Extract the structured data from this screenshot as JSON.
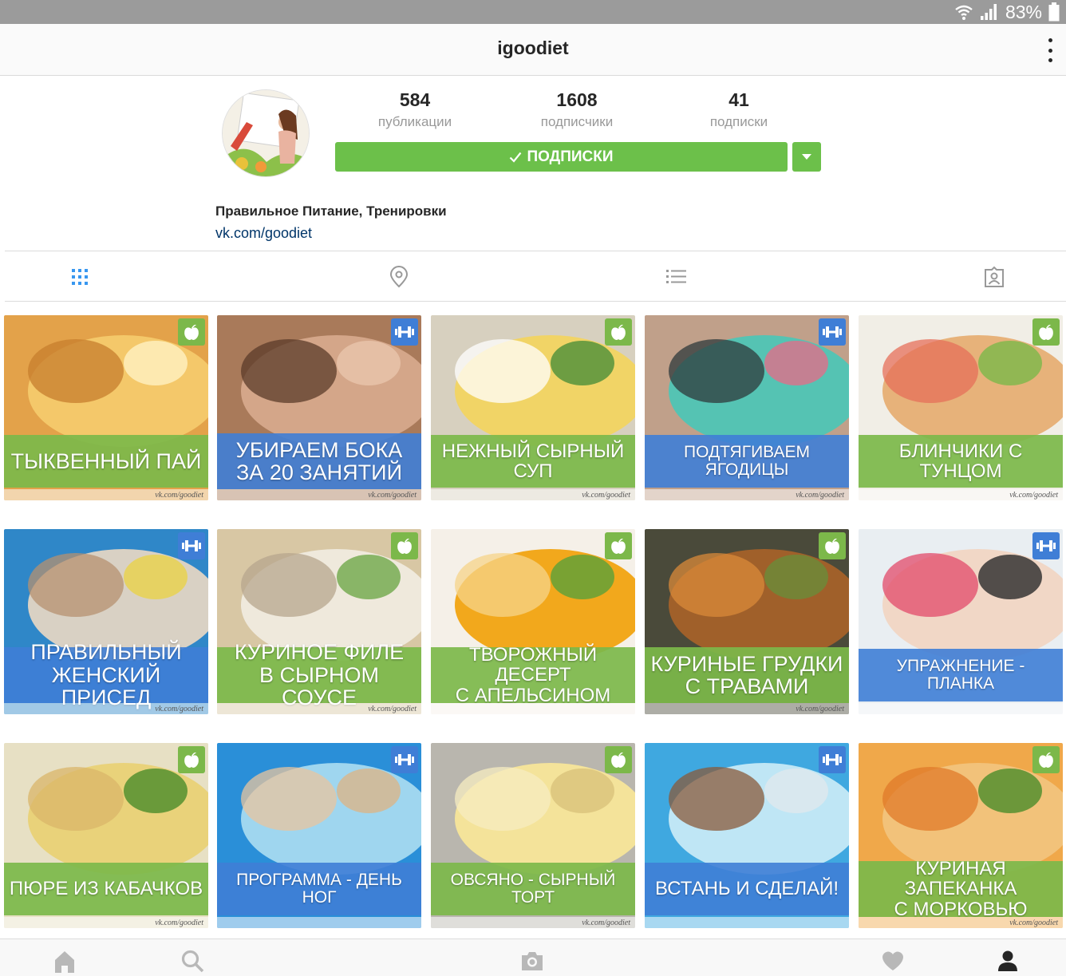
{
  "status_bar": {
    "battery_text": "83%"
  },
  "header": {
    "username": "igoodiet"
  },
  "profile": {
    "stats": [
      {
        "value": "584",
        "label": "публикации"
      },
      {
        "value": "1608",
        "label": "подписчики"
      },
      {
        "value": "41",
        "label": "подписки"
      }
    ],
    "follow_button_label": "ПОДПИСКИ",
    "bio_name": "Правильное Питание, Тренировки",
    "bio_link": "vk.com/goodiet"
  },
  "tabs": [
    "grid-icon",
    "location-pin-icon",
    "list-icon",
    "tagged-person-icon"
  ],
  "colors": {
    "green": "#6cc04a",
    "band_green": "#7cb84a",
    "band_blue": "#3f7ed6",
    "link": "#003569"
  },
  "posts": [
    {
      "line1": "ТЫКВЕННЫЙ ПАЙ",
      "line2": "",
      "badge": "apple-icon",
      "footer": "vk.com/goodiet"
    },
    {
      "line1": "УБИРАЕМ БОКА",
      "line2": "ЗА 20 ЗАНЯТИЙ",
      "badge": "dumbbell-icon",
      "footer": "vk.com/goodiet"
    },
    {
      "line1": "НЕЖНЫЙ СЫРНЫЙ СУП",
      "line2": "",
      "badge": "apple-icon",
      "footer": "vk.com/goodiet"
    },
    {
      "line1": "ПОДТЯГИВАЕМ ЯГОДИЦЫ",
      "line2": "",
      "badge": "dumbbell-icon",
      "footer": "vk.com/goodiet"
    },
    {
      "line1": "БЛИНЧИКИ С ТУНЦОМ",
      "line2": "",
      "badge": "apple-icon",
      "footer": "vk.com/goodiet"
    },
    {
      "line1": "ПРАВИЛЬНЫЙ",
      "line2": "ЖЕНСКИЙ ПРИСЕД",
      "badge": "dumbbell-icon",
      "footer": "vk.com/goodiet"
    },
    {
      "line1": "КУРИНОЕ ФИЛЕ",
      "line2": "В СЫРНОМ СОУСЕ",
      "badge": "apple-icon",
      "footer": "vk.com/goodiet"
    },
    {
      "line1": "ТВОРОЖНЫЙ ДЕСЕРТ",
      "line2": "С АПЕЛЬСИНОМ",
      "badge": "apple-icon",
      "footer": ""
    },
    {
      "line1": "КУРИНЫЕ ГРУДКИ",
      "line2": "С ТРАВАМИ",
      "badge": "apple-icon",
      "footer": "vk.com/goodiet"
    },
    {
      "line1": "УПРАЖНЕНИЕ - ПЛАНКА",
      "line2": "",
      "badge": "dumbbell-icon",
      "footer": ""
    },
    {
      "line1": "ПЮРЕ ИЗ КАБАЧКОВ",
      "line2": "",
      "badge": "apple-icon",
      "footer": "vk.com/goodiet"
    },
    {
      "line1": "ПРОГРАММА - ДЕНЬ НОГ",
      "line2": "",
      "badge": "dumbbell-icon",
      "footer": ""
    },
    {
      "line1": "ОВСЯНО - СЫРНЫЙ ТОРТ",
      "line2": "",
      "badge": "apple-icon",
      "footer": "vk.com/goodiet"
    },
    {
      "line1": "ВСТАНЬ И СДЕЛАЙ!",
      "line2": "",
      "badge": "dumbbell-icon",
      "footer": ""
    },
    {
      "line1": "КУРИНАЯ ЗАПЕКАНКА",
      "line2": "С МОРКОВЬЮ",
      "badge": "apple-icon",
      "footer": "vk.com/goodiet"
    }
  ],
  "bottom_nav": [
    "home-icon",
    "search-icon",
    "camera-icon",
    "heart-icon",
    "profile-icon"
  ]
}
